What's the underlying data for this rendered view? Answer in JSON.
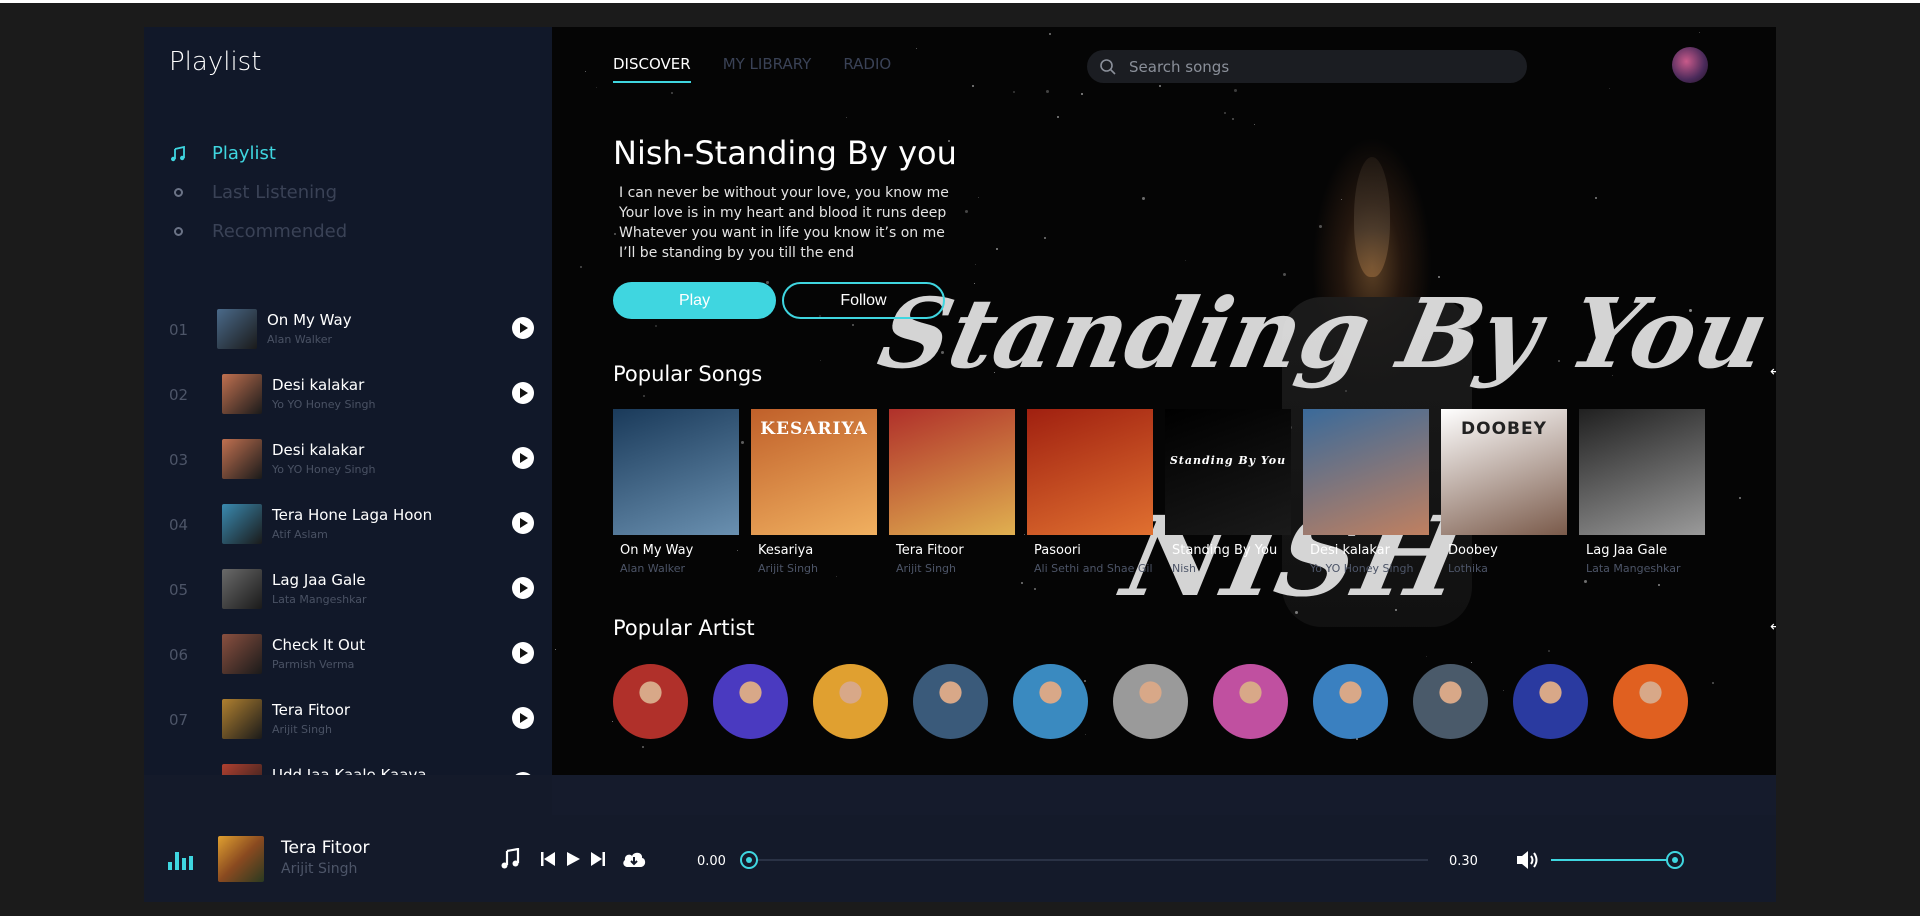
{
  "sidebar": {
    "title": "Playlist",
    "nav": [
      {
        "label": "Playlist",
        "icon": "music-note-icon",
        "active": true
      },
      {
        "label": "Last Listening",
        "icon": "circle-icon",
        "active": false
      },
      {
        "label": "Recommended",
        "icon": "circle-icon",
        "active": false
      }
    ],
    "tracks": [
      {
        "num": "01",
        "name": "On My Way",
        "artist": "Alan Walker",
        "color": "#4a6a8a"
      },
      {
        "num": "02",
        "name": "Desi kalakar",
        "artist": "Yo YO Honey Singh",
        "color": "#c07050"
      },
      {
        "num": "03",
        "name": "Desi kalakar",
        "artist": "Yo YO Honey Singh",
        "color": "#c07050"
      },
      {
        "num": "04",
        "name": "Tera Hone Laga Hoon",
        "artist": "Atif Aslam",
        "color": "#3a8ab0"
      },
      {
        "num": "05",
        "name": "Lag Jaa Gale",
        "artist": "Lata Mangeshkar",
        "color": "#6a6a6a"
      },
      {
        "num": "06",
        "name": "Check It Out",
        "artist": "Parmish Verma",
        "color": "#8a5040"
      },
      {
        "num": "07",
        "name": "Tera Fitoor",
        "artist": "Arijit Singh",
        "color": "#b08030"
      },
      {
        "num": "",
        "name": "Udd Jaa Kaale Kaava",
        "artist": "",
        "color": "#b04030"
      }
    ]
  },
  "tabs": [
    {
      "label": "DISCOVER",
      "active": true
    },
    {
      "label": "MY LIBRARY",
      "active": false
    },
    {
      "label": "RADIO",
      "active": false
    }
  ],
  "search": {
    "placeholder": "Search songs"
  },
  "hero": {
    "title": "Nish-Standing By you",
    "lyrics": [
      "I can never be without your love, you know me",
      "Your love is in my heart and blood it runs deep",
      "Whatever you want in life you know it’s on me",
      "I’ll be standing by you till the end"
    ],
    "play_label": "Play",
    "follow_label": "Follow",
    "background_script": "Standing By You",
    "background_script_2": "NISH"
  },
  "popular_songs": {
    "title": "Popular Songs",
    "prev_icon": "arrow-left-icon",
    "next_icon": "arrow-right-icon",
    "items": [
      {
        "name": "On My Way",
        "artist": "Alan Walker",
        "cover_text": "",
        "color1": "#1a3a5a",
        "color2": "#6a90b0"
      },
      {
        "name": "Kesariya",
        "artist": "Arijit Singh",
        "cover_text": "KESARIYA",
        "color1": "#c0602a",
        "color2": "#f0b060"
      },
      {
        "name": "Tera Fitoor",
        "artist": "Arijit Singh",
        "cover_text": "",
        "color1": "#b0302a",
        "color2": "#e0b050"
      },
      {
        "name": "Pasoori",
        "artist": "Ali Sethi and Shae Gill",
        "cover_text": "",
        "color1": "#a02010",
        "color2": "#e07030"
      },
      {
        "name": "Standing By You",
        "artist": "Nish",
        "cover_text": "Standing By You",
        "color1": "#000000",
        "color2": "#1a1a1a"
      },
      {
        "name": "Desi kalakar",
        "artist": "Yo YO Honey Singh",
        "cover_text": "",
        "color1": "#3a6a9a",
        "color2": "#c08060"
      },
      {
        "name": "Doobey",
        "artist": "Lothika",
        "cover_text": "DOOBEY",
        "color1": "#ffffff",
        "color2": "#7a5a4a"
      },
      {
        "name": "Lag Jaa Gale",
        "artist": "Lata Mangeshkar",
        "cover_text": "",
        "color1": "#202020",
        "color2": "#9a9a9a"
      }
    ]
  },
  "popular_artist": {
    "title": "Popular Artist",
    "prev_icon": "arrow-left-icon",
    "next_icon": "arrow-right-icon",
    "colors": [
      "#b0302a",
      "#4a3ac0",
      "#e0a030",
      "#3a5a7a",
      "#3a8ac0",
      "#9a9a9a",
      "#c050a0",
      "#3a80c0",
      "#4a5a6a",
      "#2a3aa0",
      "#e06020"
    ]
  },
  "player": {
    "now_playing_title": "Tera Fitoor",
    "now_playing_artist": "Arijit Singh",
    "current_time": "0.00",
    "duration": "0.30",
    "progress": 0.0,
    "volume": 1.0,
    "icons": [
      "equalizer-icon",
      "music-note-icon",
      "previous-icon",
      "play-icon",
      "next-icon",
      "download-icon",
      "volume-icon"
    ]
  },
  "colors": {
    "accent": "#3fd6e0",
    "sidebar_bg": "#111829",
    "main_bg": "#050505"
  }
}
